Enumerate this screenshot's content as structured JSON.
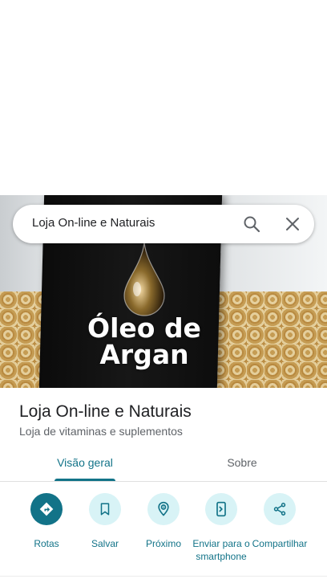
{
  "search": {
    "query": "Loja On-line e Naturais",
    "search_icon": "search-icon",
    "close_icon": "close-icon"
  },
  "hero": {
    "product_text_line1": "Óleo de",
    "product_text_line2": "Argan"
  },
  "place": {
    "title": "Loja On-line e Naturais",
    "category": "Loja de vitaminas e suplementos"
  },
  "tabs": [
    {
      "label": "Visão geral",
      "active": true
    },
    {
      "label": "Sobre",
      "active": false
    }
  ],
  "actions": [
    {
      "label": "Rotas",
      "icon": "directions-icon"
    },
    {
      "label": "Salvar",
      "icon": "bookmark-icon"
    },
    {
      "label": "Próximo",
      "icon": "nearby-icon"
    },
    {
      "label": "Enviar para o smartphone",
      "icon": "send-to-phone-icon"
    },
    {
      "label": "Compartilhar",
      "icon": "share-icon"
    }
  ],
  "colors": {
    "accent": "#127388",
    "accent_light": "#d8f3f6",
    "text_primary": "#202124",
    "text_secondary": "#5f6368"
  }
}
